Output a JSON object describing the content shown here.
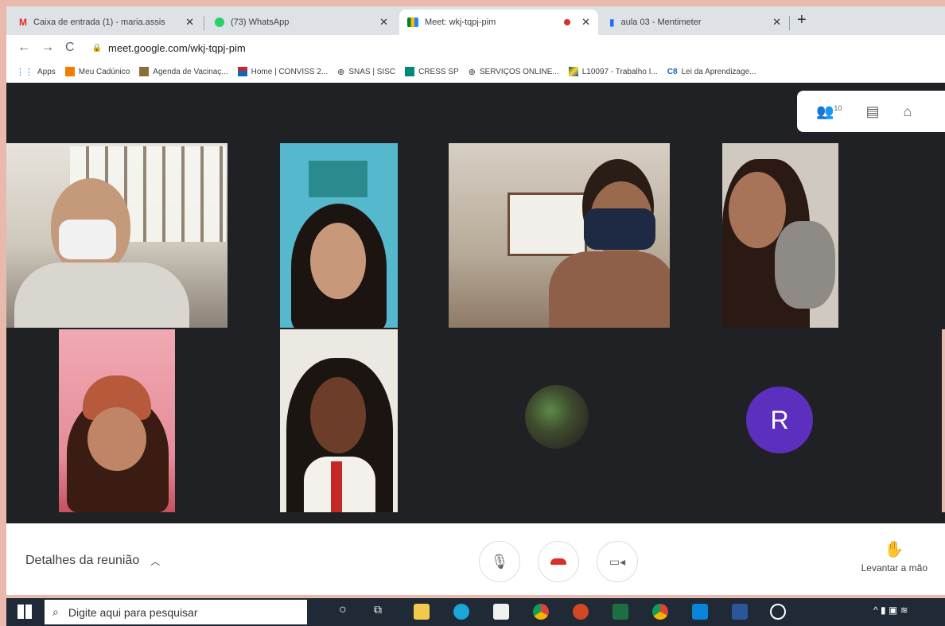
{
  "browser": {
    "tabs": [
      {
        "label": "Caixa de entrada (1) - maria.assis",
        "icon": "gmail-icon"
      },
      {
        "label": "(73) WhatsApp",
        "icon": "whatsapp-icon"
      },
      {
        "label": "Meet: wkj-tqpj-pim",
        "icon": "meet-icon",
        "active": true
      },
      {
        "label": "aula 03 - Mentimeter",
        "icon": "mentimeter-icon"
      }
    ],
    "url": "meet.google.com/wkj-tqpj-pim",
    "bookmarks": [
      "Apps",
      "Meu Cadúnico",
      "Agenda de Vacinaç...",
      "Home | CONVISS 2...",
      "SNAS | SISC",
      "CRESS SP",
      "SERVIÇOS ONLINE...",
      "L10097 - Trabalho I...",
      "Lei da Aprendizage..."
    ]
  },
  "meet": {
    "participant_count": "10",
    "avatar_letter": "R",
    "details_label": "Detalhes da reunião",
    "raise_hand_label": "Levantar a mão"
  },
  "taskbar": {
    "search_placeholder": "Digite aqui para pesquisar"
  },
  "colors": {
    "meet_bg": "#202124",
    "avatar_purple": "#5d2fbe",
    "hangup_red": "#d93025",
    "border_pink": "#e9b9ad"
  }
}
